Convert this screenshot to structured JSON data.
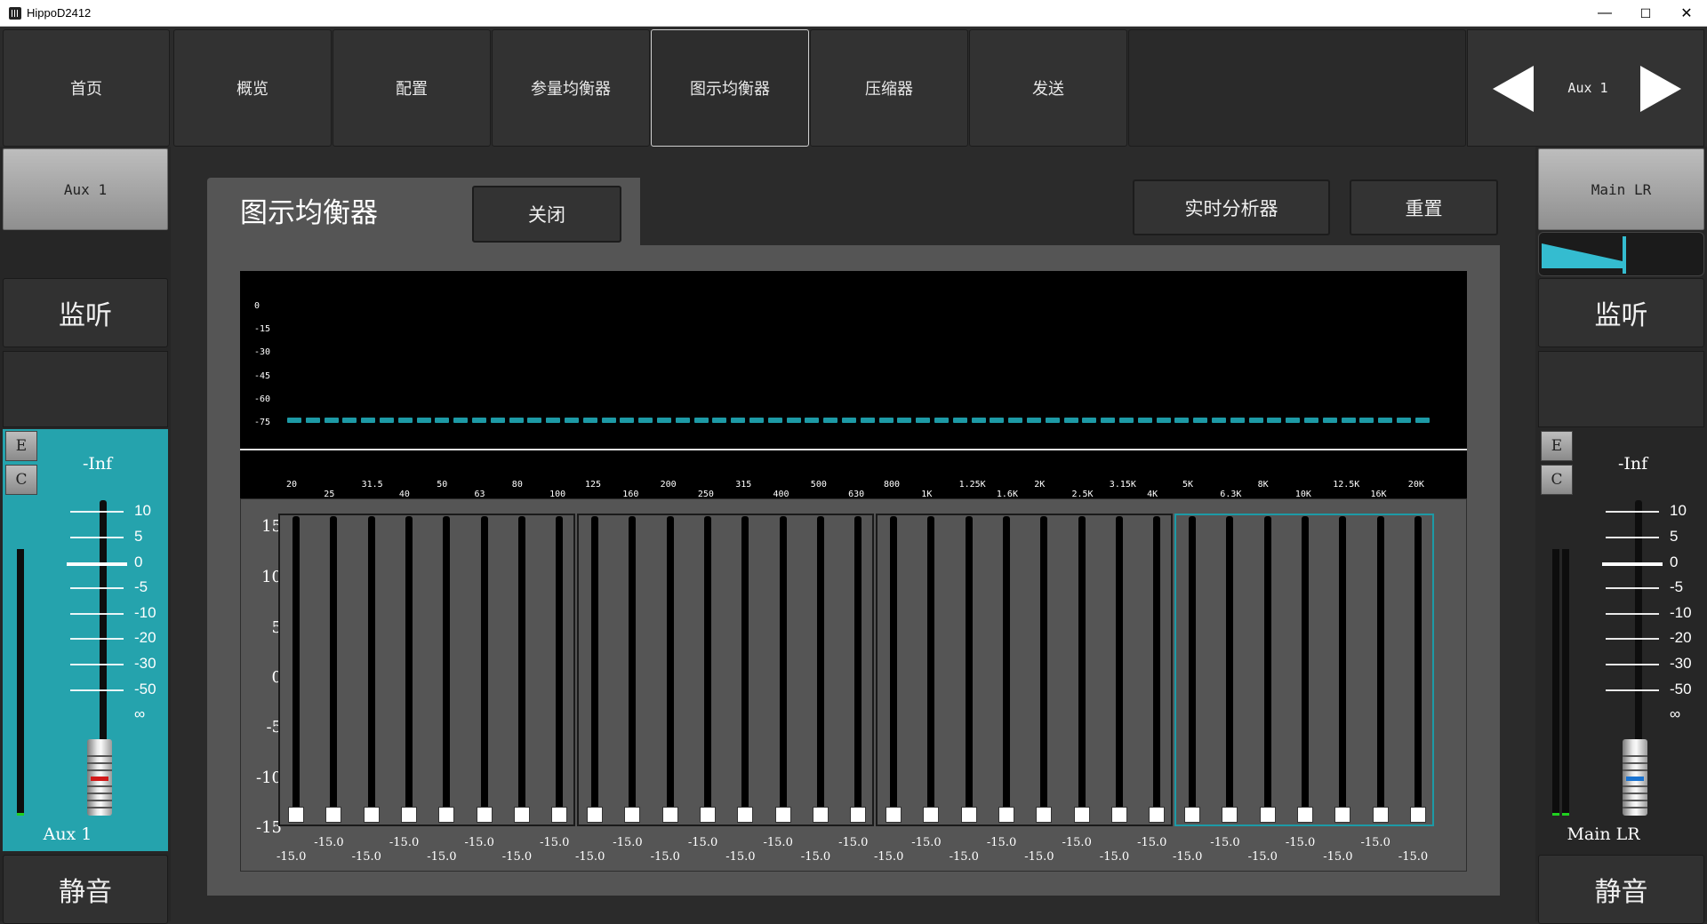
{
  "window": {
    "title": "HippoD2412",
    "minimize": "—",
    "maximize": "☐",
    "close": "✕"
  },
  "tabs": [
    {
      "label": "首页"
    },
    {
      "label": "概览"
    },
    {
      "label": "配置"
    },
    {
      "label": "参量均衡器"
    },
    {
      "label": "图示均衡器",
      "active": true
    },
    {
      "label": "压缩器"
    },
    {
      "label": "发送"
    }
  ],
  "channel_nav": {
    "label": "Aux 1",
    "prev_icon": "triangle-left-icon",
    "next_icon": "triangle-right-icon"
  },
  "left_strip": {
    "name_button": "Aux 1",
    "monitor": "监听",
    "e_button": "E",
    "c_button": "C",
    "level": "-Inf",
    "scale": [
      "10",
      "5",
      "0",
      "-5",
      "-10",
      "-20",
      "-30",
      "-50",
      "∞"
    ],
    "fader_label": "Aux 1",
    "mute": "静音",
    "fader_cap_color": "#d11a1a"
  },
  "right_strip": {
    "name_button": "Main LR",
    "monitor": "监听",
    "e_button": "E",
    "c_button": "C",
    "level": "-Inf",
    "scale": [
      "10",
      "5",
      "0",
      "-5",
      "-10",
      "-20",
      "-30",
      "-50",
      "∞"
    ],
    "fader_label": "Main LR",
    "mute": "静音",
    "fader_cap_color": "#1a73d1"
  },
  "geq": {
    "title": "图示均衡器",
    "close_button": "关闭",
    "rta_button": "实时分析器",
    "reset_button": "重置",
    "spectrum_db_labels": [
      "0",
      "-15",
      "-30",
      "-45",
      "-60",
      "-75"
    ],
    "gain_axis": [
      "15",
      "10",
      "5",
      "0",
      "-5",
      "-10",
      "-15"
    ],
    "frequencies": [
      "20",
      "25",
      "31.5",
      "40",
      "50",
      "63",
      "80",
      "100",
      "125",
      "160",
      "200",
      "250",
      "315",
      "400",
      "500",
      "630",
      "800",
      "1K",
      "1.25K",
      "1.6K",
      "2K",
      "2.5K",
      "3.15K",
      "4K",
      "5K",
      "6.3K",
      "8K",
      "10K",
      "12.5K",
      "16K",
      "20K"
    ],
    "gains": [
      "-15.0",
      "-15.0",
      "-15.0",
      "-15.0",
      "-15.0",
      "-15.0",
      "-15.0",
      "-15.0",
      "-15.0",
      "-15.0",
      "-15.0",
      "-15.0",
      "-15.0",
      "-15.0",
      "-15.0",
      "-15.0",
      "-15.0",
      "-15.0",
      "-15.0",
      "-15.0",
      "-15.0",
      "-15.0",
      "-15.0",
      "-15.0",
      "-15.0",
      "-15.0",
      "-15.0",
      "-15.0",
      "-15.0",
      "-15.0",
      "-15.0"
    ],
    "selected_group": 4,
    "accent_color": "#1d9aa6"
  }
}
